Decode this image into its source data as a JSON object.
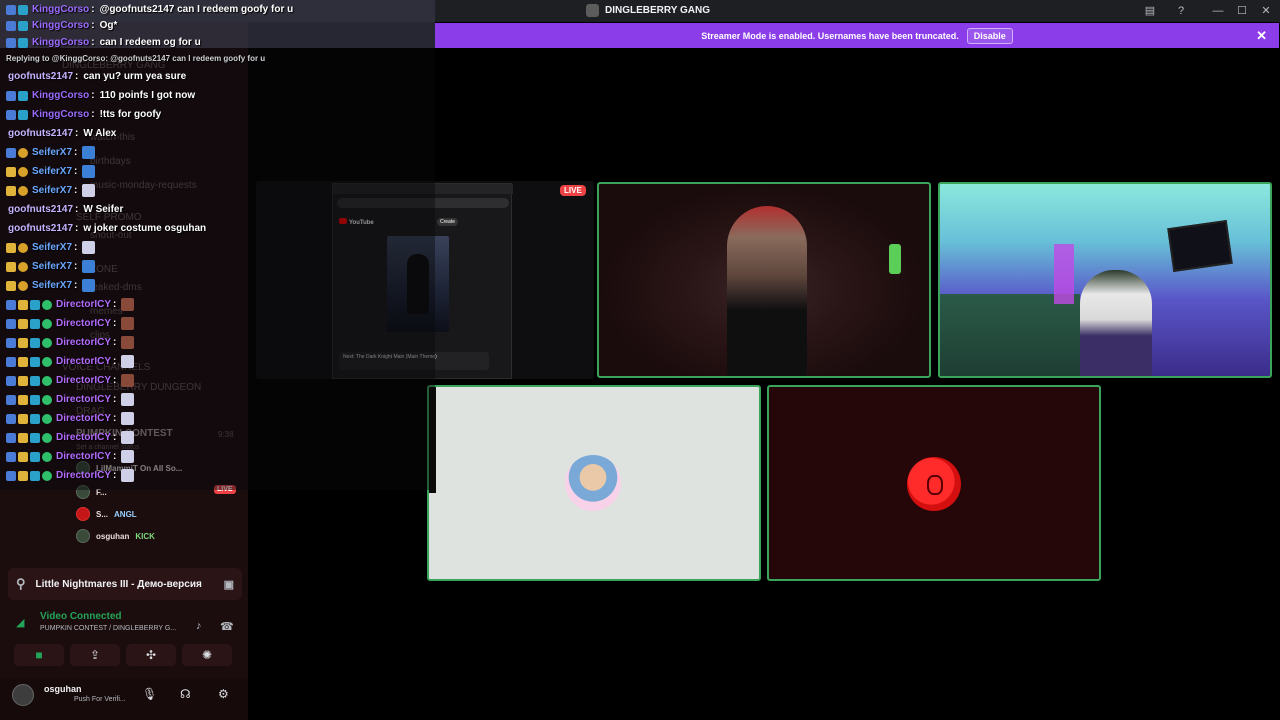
{
  "window": {
    "title": "DINGLEBERRY GANG"
  },
  "banner": {
    "text": "Streamer Mode is enabled. Usernames have been truncated.",
    "button": "Disable"
  },
  "chat": {
    "reply_line": "Replying to @KinggCorso: @goofnuts2147 can I redeem goofy for u",
    "messages": [
      {
        "user": "KinggCorso",
        "color": "#9b6bff",
        "text": "@goofnuts2147 can I redeem goofy for u",
        "badges": [
          "b-blue",
          "b-cyan"
        ]
      },
      {
        "user": "KinggCorso",
        "color": "#9b6bff",
        "text": "Og*",
        "badges": [
          "b-blue",
          "b-cyan"
        ]
      },
      {
        "user": "KinggCorso",
        "color": "#9b6bff",
        "text": "can I redeem og for u",
        "badges": [
          "b-blue",
          "b-cyan"
        ]
      },
      {
        "user": "goofnuts2147",
        "color": "#c6b3ff",
        "text": "can yu? urm yea sure",
        "badges": []
      },
      {
        "user": "KinggCorso",
        "color": "#9b6bff",
        "text": "110 poinfs I got now",
        "badges": [
          "b-blue",
          "b-cyan"
        ]
      },
      {
        "user": "KinggCorso",
        "color": "#9b6bff",
        "text": "!tts for goofy",
        "badges": [
          "b-blue",
          "b-cyan"
        ]
      },
      {
        "user": "goofnuts2147",
        "color": "#c6b3ff",
        "text": "W Alex",
        "badges": []
      },
      {
        "user": "SeiferX7",
        "color": "#6aa7ff",
        "text": "",
        "emote": "e-w",
        "badges": [
          "b-blue",
          "b-gold"
        ]
      },
      {
        "user": "SeiferX7",
        "color": "#6aa7ff",
        "text": "",
        "emote": "e-w",
        "badges": [
          "b-crown",
          "b-gold"
        ]
      },
      {
        "user": "SeiferX7",
        "color": "#6aa7ff",
        "text": "",
        "emote": "e-bow",
        "badges": [
          "b-crown",
          "b-gold"
        ]
      },
      {
        "user": "goofnuts2147",
        "color": "#c6b3ff",
        "text": "W Seifer",
        "badges": []
      },
      {
        "user": "goofnuts2147",
        "color": "#c6b3ff",
        "text": "w joker costume osguhan",
        "badges": []
      },
      {
        "user": "SeiferX7",
        "color": "#6aa7ff",
        "text": "",
        "emote": "e-bow",
        "badges": [
          "b-crown",
          "b-gold"
        ]
      },
      {
        "user": "SeiferX7",
        "color": "#6aa7ff",
        "text": "",
        "emote": "e-w",
        "badges": [
          "b-crown",
          "b-gold"
        ]
      },
      {
        "user": "SeiferX7",
        "color": "#6aa7ff",
        "text": "",
        "emote": "e-w",
        "badges": [
          "b-crown",
          "b-gold"
        ]
      },
      {
        "user": "DirectorICY",
        "color": "#b46bff",
        "text": "",
        "emote": "e-heart",
        "badges": [
          "b-blue",
          "b-crown",
          "b-cyan",
          "b-green"
        ]
      },
      {
        "user": "DirectorICY",
        "color": "#b46bff",
        "text": "",
        "emote": "e-heart",
        "badges": [
          "b-blue",
          "b-crown",
          "b-cyan",
          "b-green"
        ]
      },
      {
        "user": "DirectorICY",
        "color": "#b46bff",
        "text": "",
        "emote": "e-heart",
        "badges": [
          "b-blue",
          "b-crown",
          "b-cyan",
          "b-green"
        ]
      },
      {
        "user": "DirectorICY",
        "color": "#b46bff",
        "text": "",
        "emote": "e-bow",
        "badges": [
          "b-blue",
          "b-crown",
          "b-cyan",
          "b-green"
        ]
      },
      {
        "user": "DirectorICY",
        "color": "#b46bff",
        "text": "",
        "emote": "e-heart",
        "badges": [
          "b-blue",
          "b-crown",
          "b-cyan",
          "b-green"
        ]
      },
      {
        "user": "DirectorICY",
        "color": "#b46bff",
        "text": "",
        "emote": "e-bow",
        "badges": [
          "b-blue",
          "b-crown",
          "b-cyan",
          "b-green"
        ]
      },
      {
        "user": "DirectorICY",
        "color": "#b46bff",
        "text": "",
        "emote": "e-bow",
        "badges": [
          "b-blue",
          "b-crown",
          "b-cyan",
          "b-green"
        ]
      },
      {
        "user": "DirectorICY",
        "color": "#b46bff",
        "text": "",
        "emote": "e-bow",
        "badges": [
          "b-blue",
          "b-crown",
          "b-cyan",
          "b-green"
        ]
      },
      {
        "user": "DirectorICY",
        "color": "#b46bff",
        "text": "",
        "emote": "e-bow",
        "badges": [
          "b-blue",
          "b-crown",
          "b-cyan",
          "b-green"
        ]
      },
      {
        "user": "DirectorICY",
        "color": "#b46bff",
        "text": "",
        "emote": "e-bow",
        "badges": [
          "b-blue",
          "b-crown",
          "b-cyan",
          "b-green"
        ]
      }
    ]
  },
  "sidebar": {
    "server_name": "DINGLEBERRY GANG",
    "faint_channels": [
      "watch-this",
      "birthdays",
      "music-monday-requests",
      "SELF PROMO",
      "shout-out",
      "ZONE",
      "leaked-dms",
      "memes",
      "clips",
      "VOICE CHANNELS",
      "DINGLEBERRY DUNGEON",
      "DRAG",
      "PUMPKIN CONTEST",
      "Set a channel status",
      "9:38"
    ],
    "call_users": [
      {
        "name": "LilMammiT On All So...",
        "live": "LIVE"
      },
      {
        "name": "F..."
      },
      {
        "name": "S...",
        "tag": "ANGL"
      },
      {
        "name": "osguhan",
        "tag": "KICK"
      }
    ]
  },
  "activity": {
    "game": "Little Nightmares III - Демо-версия"
  },
  "voice": {
    "status": "Video Connected",
    "channel": "PUMPKIN CONTEST / DINGLEBERRY G..."
  },
  "user": {
    "name": "osguhan",
    "status": "Push For Verifi..."
  },
  "stream": {
    "live_label": "LIVE",
    "youtube": {
      "logo": "YouTube",
      "create": "Create",
      "next": "Next: The Dark Knight Main (Main Theme)"
    }
  }
}
